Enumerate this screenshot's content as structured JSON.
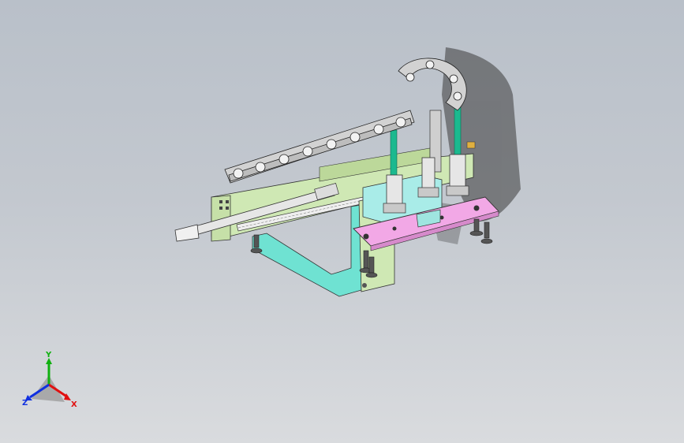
{
  "viewport": {
    "background_top": "#b9c0c9",
    "background_bottom": "#d9dbde"
  },
  "model": {
    "description_icon": "cad-assembly-icon",
    "colors": {
      "frame_green": "#cfe8b4",
      "bracket_cyan": "#6fe2d2",
      "plate_pink": "#f2a8e6",
      "block_cyan": "#a9ece8",
      "rod_teal": "#1bb98f",
      "chain_grey": "#d2d2d2",
      "cylinder_grey": "#e6e6e6",
      "shadow": "#3a3a3a"
    }
  },
  "triad": {
    "x_label": "X",
    "y_label": "Y",
    "z_label": "Z",
    "x_color": "#e01010",
    "y_color": "#10b010",
    "z_color": "#1030e0"
  }
}
